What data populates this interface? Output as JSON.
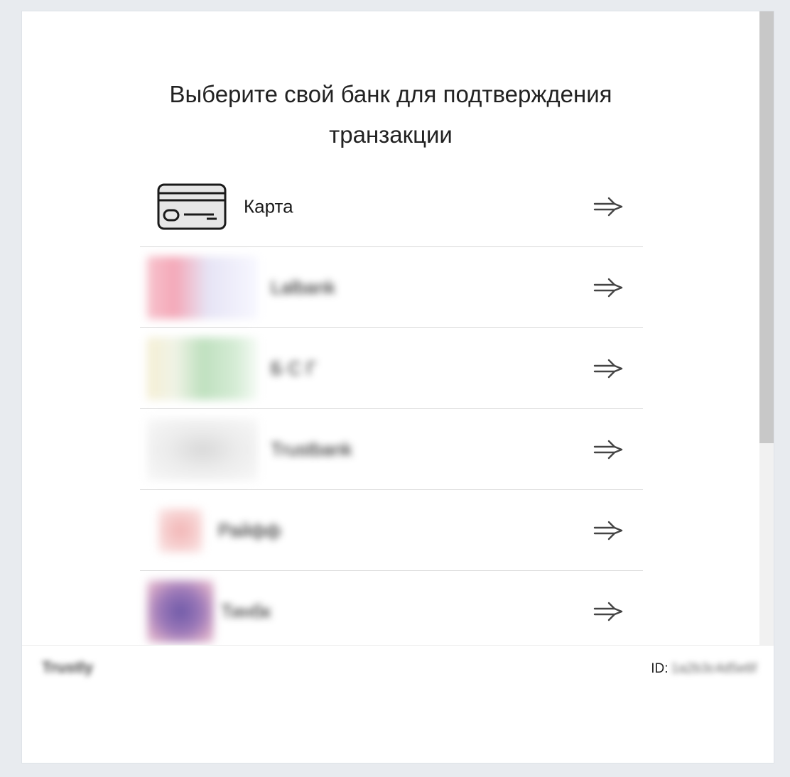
{
  "header": {
    "title_line1": "Выберите свой банк для подтверждения",
    "title_line2": "транзакции"
  },
  "banks": [
    {
      "label": "Карта",
      "icon": "credit-card-icon"
    },
    {
      "label": "Lalbank",
      "logo_colors": [
        "#f4a8b8",
        "#c8c8f0"
      ]
    },
    {
      "label": "Б С Г",
      "logo_colors": [
        "#f0e6b8",
        "#9fd19f"
      ]
    },
    {
      "label": "Trustbank",
      "logo_colors": [
        "#d6d6d6"
      ]
    },
    {
      "label": "Райфф",
      "logo_colors": [
        "#f2b5b5"
      ]
    },
    {
      "label": "Тинбк",
      "logo_colors": [
        "#7b5ea7",
        "#c98ab4"
      ]
    }
  ],
  "footer": {
    "brand": "Trustly",
    "id_label": "ID:",
    "id_value": "1a2b3c4d5e6f"
  },
  "icons": {
    "arrow": "arrow-right-icon",
    "card": "credit-card-icon"
  },
  "colors": {
    "background": "#e8ebef",
    "panel": "#ffffff",
    "divider": "#d9d9d9",
    "text": "#222222"
  }
}
